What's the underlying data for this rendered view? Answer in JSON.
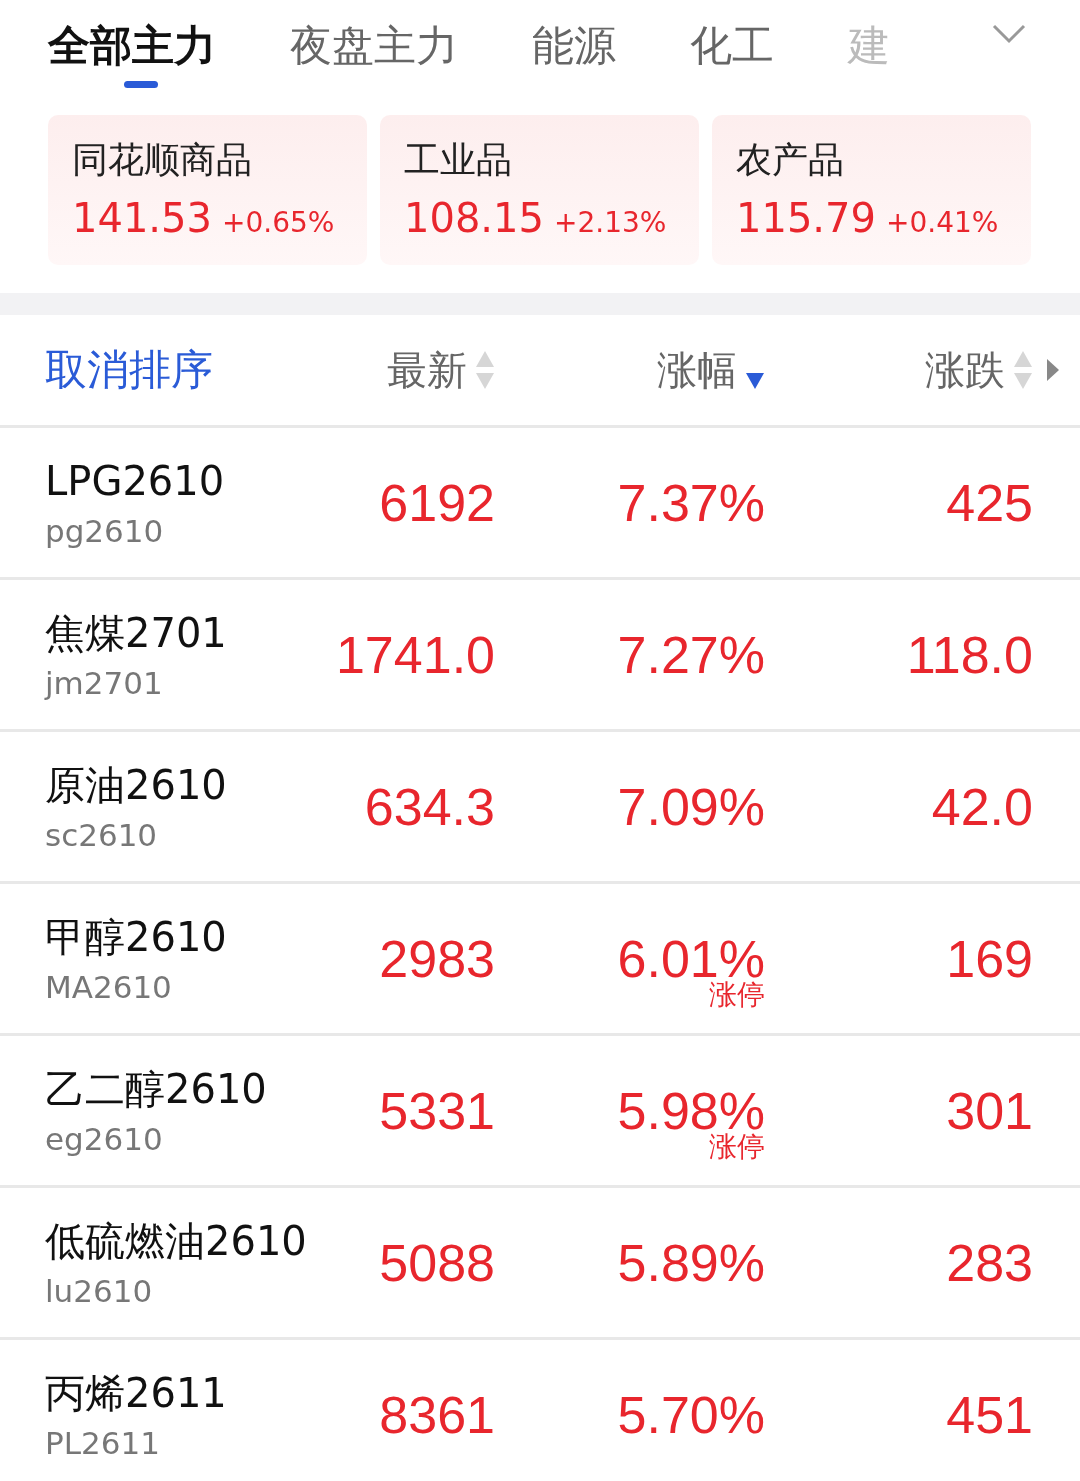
{
  "tabs": [
    {
      "label": "全部主力",
      "selected": true
    },
    {
      "label": "夜盘主力",
      "selected": false
    },
    {
      "label": "能源",
      "selected": false
    },
    {
      "label": "化工",
      "selected": false
    },
    {
      "label": "建",
      "selected": false
    }
  ],
  "indices": [
    {
      "name": "同花顺商品",
      "value": "141.53",
      "change": "+0.65%"
    },
    {
      "name": "工业品",
      "value": "108.15",
      "change": "+2.13%"
    },
    {
      "name": "农产品",
      "value": "115.79",
      "change": "+0.41%"
    }
  ],
  "header": {
    "cancel_sort": "取消排序",
    "columns": [
      {
        "label": "最新",
        "sorted_descending": false
      },
      {
        "label": "涨幅",
        "sorted_descending": true
      },
      {
        "label": "涨跌",
        "sorted_descending": false
      }
    ]
  },
  "rows": [
    {
      "name": "LPG2610",
      "code": "pg2610",
      "price": "6192",
      "pct": "7.37%",
      "change": "425"
    },
    {
      "name": "焦煤2701",
      "code": "jm2701",
      "price": "1741.0",
      "pct": "7.27%",
      "change": "118.0"
    },
    {
      "name": "原油2610",
      "code": "sc2610",
      "price": "634.3",
      "pct": "7.09%",
      "change": "42.0"
    },
    {
      "name": "甲醇2610",
      "code": "MA2610",
      "price": "2983",
      "pct": "6.01%",
      "tag": "涨停",
      "change": "169"
    },
    {
      "name": "乙二醇2610",
      "code": "eg2610",
      "price": "5331",
      "pct": "5.98%",
      "tag": "涨停",
      "change": "301"
    },
    {
      "name": "低硫燃油2610",
      "code": "lu2610",
      "price": "5088",
      "pct": "5.89%",
      "change": "283"
    },
    {
      "name": "丙烯2611",
      "code": "PL2611",
      "price": "8361",
      "pct": "5.70%",
      "change": "451"
    }
  ]
}
